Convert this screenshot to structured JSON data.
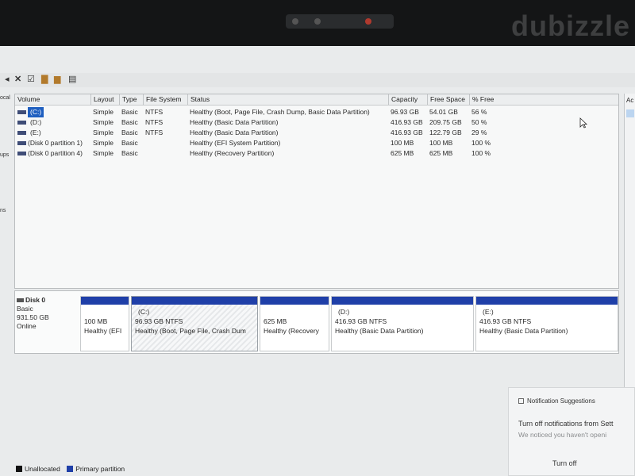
{
  "bezel": {
    "watermark": "dubizzle"
  },
  "toolbar": {
    "icons": [
      "x-icon",
      "check-icon",
      "folder-icon",
      "help-icon",
      "panel-icon"
    ]
  },
  "left_strip": {
    "labels": [
      "ocal",
      "ups",
      "ns"
    ]
  },
  "volume_table": {
    "headers": [
      "Volume",
      "Layout",
      "Type",
      "File System",
      "Status",
      "Capacity",
      "Free Space",
      "% Free"
    ],
    "rows": [
      {
        "volume": "(C:)",
        "layout": "Simple",
        "type": "Basic",
        "fs": "NTFS",
        "status": "Healthy (Boot, Page File, Crash Dump, Basic Data Partition)",
        "capacity": "96.93 GB",
        "free": "54.01 GB",
        "pct": "56 %"
      },
      {
        "volume": "(D:)",
        "layout": "Simple",
        "type": "Basic",
        "fs": "NTFS",
        "status": "Healthy (Basic Data Partition)",
        "capacity": "416.93 GB",
        "free": "209.75 GB",
        "pct": "50 %"
      },
      {
        "volume": "(E:)",
        "layout": "Simple",
        "type": "Basic",
        "fs": "NTFS",
        "status": "Healthy (Basic Data Partition)",
        "capacity": "416.93 GB",
        "free": "122.79 GB",
        "pct": "29 %"
      },
      {
        "volume": "(Disk 0 partition 1)",
        "layout": "Simple",
        "type": "Basic",
        "fs": "",
        "status": "Healthy (EFI System Partition)",
        "capacity": "100 MB",
        "free": "100 MB",
        "pct": "100 %"
      },
      {
        "volume": "(Disk 0 partition 4)",
        "layout": "Simple",
        "type": "Basic",
        "fs": "",
        "status": "Healthy (Recovery Partition)",
        "capacity": "625 MB",
        "free": "625 MB",
        "pct": "100 %"
      }
    ]
  },
  "action_strip": {
    "label": "Ac"
  },
  "disk": {
    "name": "Disk 0",
    "type": "Basic",
    "size": "931.50 GB",
    "state": "Online",
    "partitions": [
      {
        "name": "",
        "size": "100 MB",
        "status": "Healthy (EFI"
      },
      {
        "name": "(C:)",
        "size": "96.93 GB NTFS",
        "status": "Healthy (Boot, Page File, Crash Dum"
      },
      {
        "name": "",
        "size": "625 MB",
        "status": "Healthy (Recovery"
      },
      {
        "name": "(D:)",
        "size": "416.93 GB NTFS",
        "status": "Healthy (Basic Data Partition)"
      },
      {
        "name": "(E:)",
        "size": "416.93 GB NTFS",
        "status": "Healthy (Basic Data Partition)"
      }
    ]
  },
  "legend": {
    "unallocated": "Unallocated",
    "primary": "Primary partition"
  },
  "colors": {
    "primary": "#1f3fa8",
    "unallocated": "#111111",
    "selection": "#1f5fc0"
  },
  "notification": {
    "header": "Notification Suggestions",
    "title": "Turn off notifications from Sett",
    "body": "We noticed you haven't openi",
    "action": "Turn off"
  }
}
